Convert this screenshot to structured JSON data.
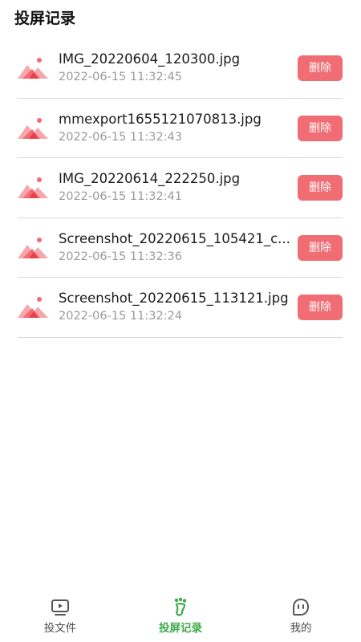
{
  "page": {
    "title": "投屏记录"
  },
  "records": [
    {
      "name": "IMG_20220604_120300.jpg",
      "time": "2022-06-15 11:32:45",
      "delete_label": "删除"
    },
    {
      "name": "mmexport1655121070813.jpg",
      "time": "2022-06-15 11:32:43",
      "delete_label": "删除"
    },
    {
      "name": "IMG_20220614_222250.jpg",
      "time": "2022-06-15 11:32:41",
      "delete_label": "删除"
    },
    {
      "name": "Screenshot_20220615_105421_c...",
      "time": "2022-06-15 11:32:36",
      "delete_label": "删除"
    },
    {
      "name": "Screenshot_20220615_113121.jpg",
      "time": "2022-06-15 11:32:24",
      "delete_label": "删除"
    }
  ],
  "tabbar": {
    "tabs": [
      {
        "label": "投文件",
        "icon": "play-screen-icon",
        "active": false
      },
      {
        "label": "投屏记录",
        "icon": "footprint-icon",
        "active": true
      },
      {
        "label": "我的",
        "icon": "chat-face-icon",
        "active": false
      }
    ]
  },
  "colors": {
    "accent": "#3daa49",
    "delete": "#f06d73",
    "thumb": "#f26b73",
    "divider": "#d9d9d9"
  }
}
